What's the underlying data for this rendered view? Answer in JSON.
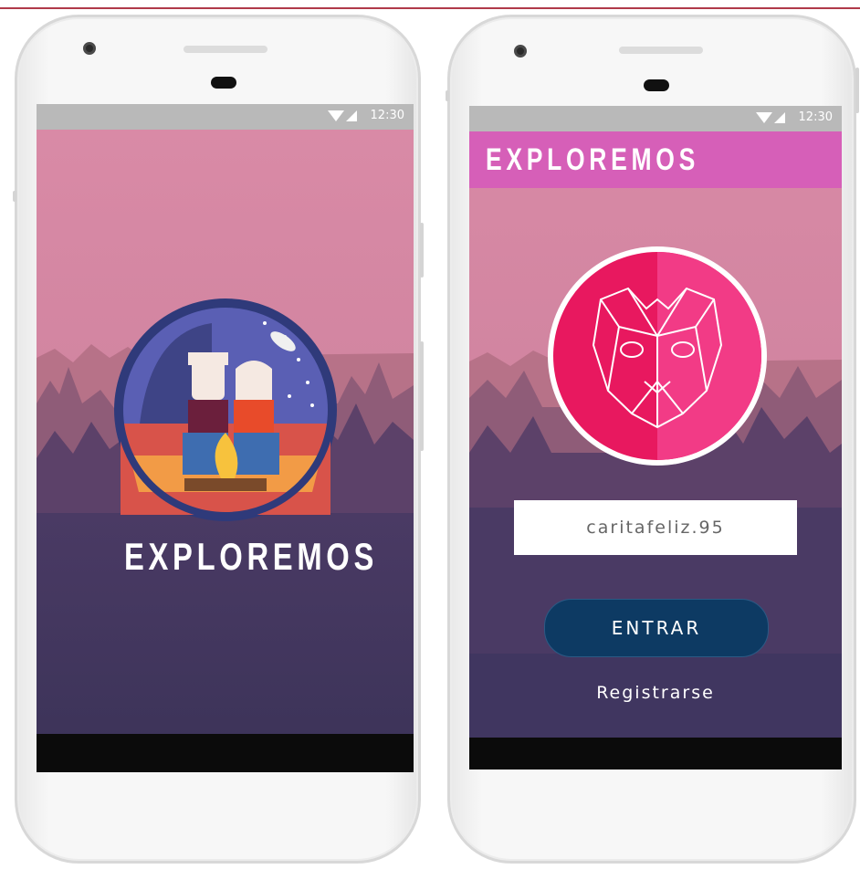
{
  "left_phone": {
    "status_time": "12:30",
    "app_name": "EXPLOREMOS"
  },
  "right_phone": {
    "status_time": "12:30",
    "appbar_title": "EXPLOREMOS",
    "username_value": "caritafeliz.95",
    "enter_label": "ENTRAR",
    "register_label": "Registrarse"
  },
  "colors": {
    "sky_top": "#d98aa6",
    "sky_bottom": "#c67d98",
    "appbar": "#d65fb8",
    "button": "#0d3a63",
    "bear_badge": "#e8185f"
  }
}
